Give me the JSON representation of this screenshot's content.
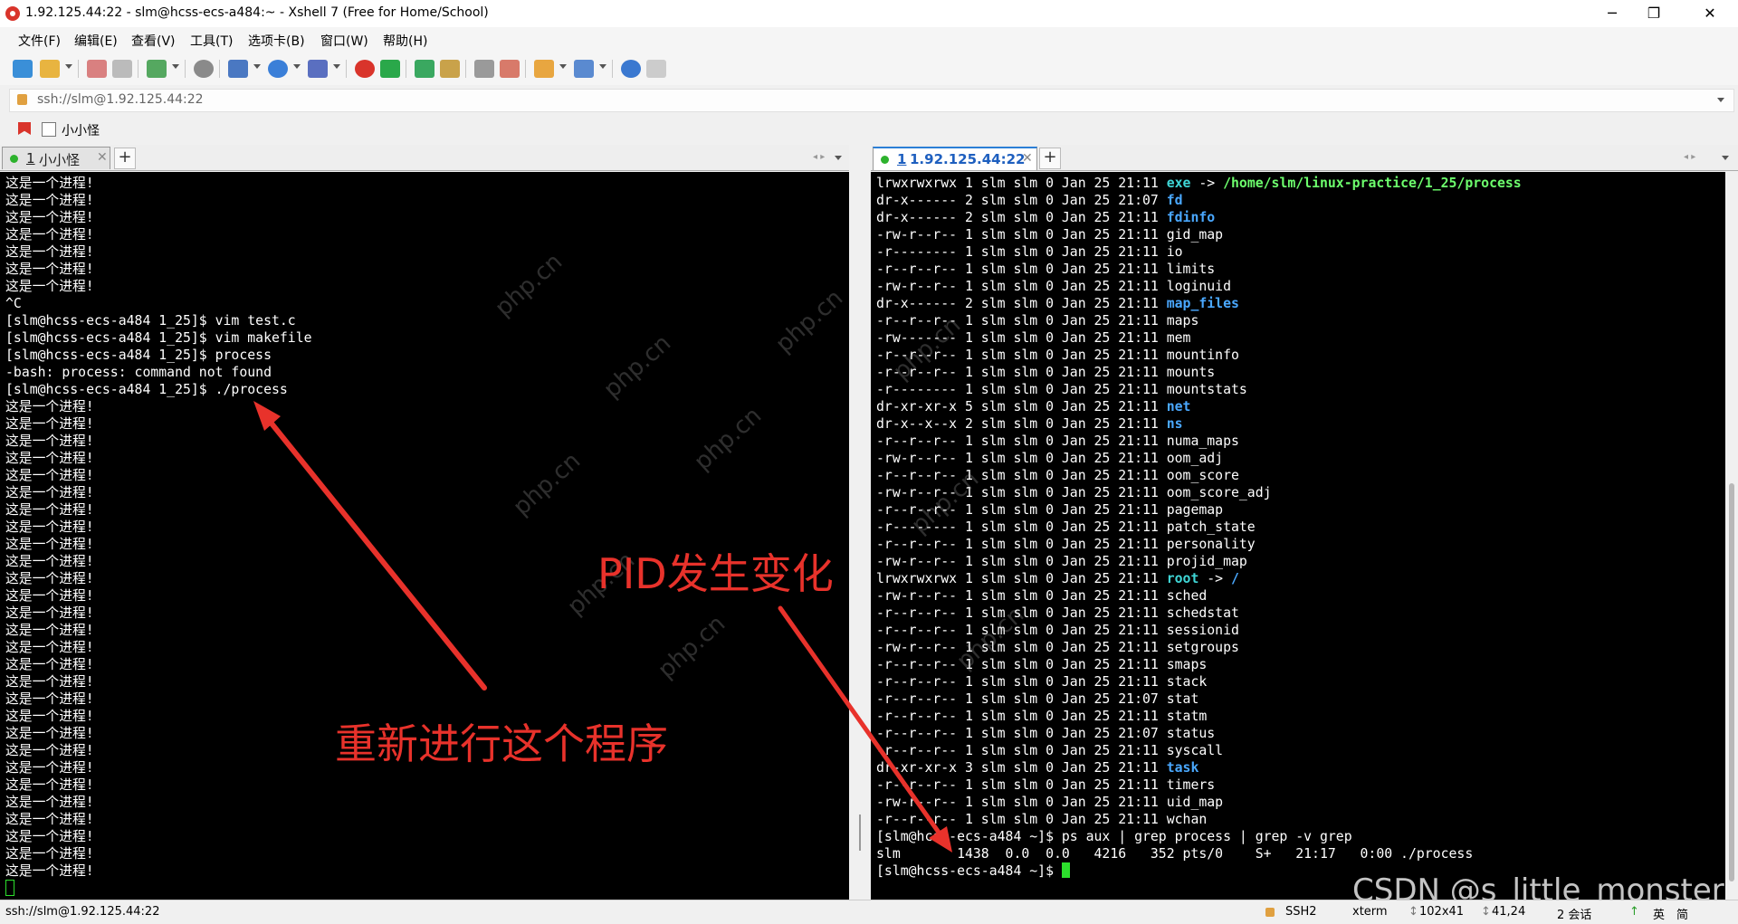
{
  "window": {
    "title": "1.92.125.44:22 - slm@hcss-ecs-a484:~ - Xshell 7 (Free for Home/School)",
    "minimize": "─",
    "maximize": "❐",
    "close": "✕"
  },
  "menu": [
    "文件(F)",
    "编辑(E)",
    "查看(V)",
    "工具(T)",
    "选项卡(B)",
    "窗口(W)",
    "帮助(H)"
  ],
  "address": "ssh://slm@1.92.125.44:22",
  "quickbar": {
    "label": "小小怪"
  },
  "tabs_left": {
    "number": "1",
    "label": "小小怪",
    "close": "✕",
    "add": "+"
  },
  "tabs_right": {
    "number": "1",
    "label": "1.92.125.44:22",
    "close": "✕",
    "add": "+"
  },
  "left_terminal": {
    "lines": [
      "这是一个进程!",
      "这是一个进程!",
      "这是一个进程!",
      "这是一个进程!",
      "这是一个进程!",
      "这是一个进程!",
      "这是一个进程!",
      "^C",
      "[slm@hcss-ecs-a484 1_25]$ vim test.c",
      "[slm@hcss-ecs-a484 1_25]$ vim makefile",
      "[slm@hcss-ecs-a484 1_25]$ process",
      "-bash: process: command not found",
      "[slm@hcss-ecs-a484 1_25]$ ./process",
      "这是一个进程!",
      "这是一个进程!",
      "这是一个进程!",
      "这是一个进程!",
      "这是一个进程!",
      "这是一个进程!",
      "这是一个进程!",
      "这是一个进程!",
      "这是一个进程!",
      "这是一个进程!",
      "这是一个进程!",
      "这是一个进程!",
      "这是一个进程!",
      "这是一个进程!",
      "这是一个进程!",
      "这是一个进程!",
      "这是一个进程!",
      "这是一个进程!",
      "这是一个进程!",
      "这是一个进程!",
      "这是一个进程!",
      "这是一个进程!",
      "这是一个进程!",
      "这是一个进程!",
      "这是一个进程!",
      "这是一个进程!",
      "这是一个进程!",
      "这是一个进程!"
    ]
  },
  "right_terminal": {
    "entries": [
      {
        "perm": "lrwxrwxrwx",
        "links": "1",
        "time": "21:11",
        "name": "exe",
        "type": "link",
        "target": "/home/slm/linux-practice/1_25/process"
      },
      {
        "perm": "dr-x------",
        "links": "2",
        "time": "21:07",
        "name": "fd",
        "type": "dir"
      },
      {
        "perm": "dr-x------",
        "links": "2",
        "time": "21:11",
        "name": "fdinfo",
        "type": "dir"
      },
      {
        "perm": "-rw-r--r--",
        "links": "1",
        "time": "21:11",
        "name": "gid_map",
        "type": "file"
      },
      {
        "perm": "-r--------",
        "links": "1",
        "time": "21:11",
        "name": "io",
        "type": "file"
      },
      {
        "perm": "-r--r--r--",
        "links": "1",
        "time": "21:11",
        "name": "limits",
        "type": "file"
      },
      {
        "perm": "-rw-r--r--",
        "links": "1",
        "time": "21:11",
        "name": "loginuid",
        "type": "file"
      },
      {
        "perm": "dr-x------",
        "links": "2",
        "time": "21:11",
        "name": "map_files",
        "type": "dir"
      },
      {
        "perm": "-r--r--r--",
        "links": "1",
        "time": "21:11",
        "name": "maps",
        "type": "file"
      },
      {
        "perm": "-rw-------",
        "links": "1",
        "time": "21:11",
        "name": "mem",
        "type": "file"
      },
      {
        "perm": "-r--r--r--",
        "links": "1",
        "time": "21:11",
        "name": "mountinfo",
        "type": "file"
      },
      {
        "perm": "-r--r--r--",
        "links": "1",
        "time": "21:11",
        "name": "mounts",
        "type": "file"
      },
      {
        "perm": "-r--------",
        "links": "1",
        "time": "21:11",
        "name": "mountstats",
        "type": "file"
      },
      {
        "perm": "dr-xr-xr-x",
        "links": "5",
        "time": "21:11",
        "name": "net",
        "type": "dir"
      },
      {
        "perm": "dr-x--x--x",
        "links": "2",
        "time": "21:11",
        "name": "ns",
        "type": "dir"
      },
      {
        "perm": "-r--r--r--",
        "links": "1",
        "time": "21:11",
        "name": "numa_maps",
        "type": "file"
      },
      {
        "perm": "-rw-r--r--",
        "links": "1",
        "time": "21:11",
        "name": "oom_adj",
        "type": "file"
      },
      {
        "perm": "-r--r--r--",
        "links": "1",
        "time": "21:11",
        "name": "oom_score",
        "type": "file"
      },
      {
        "perm": "-rw-r--r--",
        "links": "1",
        "time": "21:11",
        "name": "oom_score_adj",
        "type": "file"
      },
      {
        "perm": "-r--r--r--",
        "links": "1",
        "time": "21:11",
        "name": "pagemap",
        "type": "file"
      },
      {
        "perm": "-r--------",
        "links": "1",
        "time": "21:11",
        "name": "patch_state",
        "type": "file"
      },
      {
        "perm": "-r--r--r--",
        "links": "1",
        "time": "21:11",
        "name": "personality",
        "type": "file"
      },
      {
        "perm": "-rw-r--r--",
        "links": "1",
        "time": "21:11",
        "name": "projid_map",
        "type": "file"
      },
      {
        "perm": "lrwxrwxrwx",
        "links": "1",
        "time": "21:11",
        "name": "root",
        "type": "link",
        "target": "/"
      },
      {
        "perm": "-rw-r--r--",
        "links": "1",
        "time": "21:11",
        "name": "sched",
        "type": "file"
      },
      {
        "perm": "-r--r--r--",
        "links": "1",
        "time": "21:11",
        "name": "schedstat",
        "type": "file"
      },
      {
        "perm": "-r--r--r--",
        "links": "1",
        "time": "21:11",
        "name": "sessionid",
        "type": "file"
      },
      {
        "perm": "-rw-r--r--",
        "links": "1",
        "time": "21:11",
        "name": "setgroups",
        "type": "file"
      },
      {
        "perm": "-r--r--r--",
        "links": "1",
        "time": "21:11",
        "name": "smaps",
        "type": "file"
      },
      {
        "perm": "-r--r--r--",
        "links": "1",
        "time": "21:11",
        "name": "stack",
        "type": "file"
      },
      {
        "perm": "-r--r--r--",
        "links": "1",
        "time": "21:07",
        "name": "stat",
        "type": "file"
      },
      {
        "perm": "-r--r--r--",
        "links": "1",
        "time": "21:11",
        "name": "statm",
        "type": "file"
      },
      {
        "perm": "-r--r--r--",
        "links": "1",
        "time": "21:07",
        "name": "status",
        "type": "file"
      },
      {
        "perm": "-r--r--r--",
        "links": "1",
        "time": "21:11",
        "name": "syscall",
        "type": "file"
      },
      {
        "perm": "dr-xr-xr-x",
        "links": "3",
        "time": "21:11",
        "name": "task",
        "type": "dir"
      },
      {
        "perm": "-r--r--r--",
        "links": "1",
        "time": "21:11",
        "name": "timers",
        "type": "file"
      },
      {
        "perm": "-rw-r--r--",
        "links": "1",
        "time": "21:11",
        "name": "uid_map",
        "type": "file"
      },
      {
        "perm": "-r--r--r--",
        "links": "1",
        "time": "21:11",
        "name": "wchan",
        "type": "file"
      }
    ],
    "owner": "slm slm",
    "size": "0",
    "date": "Jan 25",
    "command_line": "[slm@hcss-ecs-a484 ~]$ ps aux | grep process | grep -v grep",
    "ps_output": "slm       1438  0.0  0.0   4216   352 pts/0    S+   21:17   0:00 ./process",
    "prompt": "[slm@hcss-ecs-a484 ~]$ "
  },
  "annotations": {
    "left": "重新进行这个程序",
    "right": "PID发生变化",
    "color": "#e8322b"
  },
  "watermark": {
    "text": "php.cn",
    "credit": "CSDN @s_little_monster_"
  },
  "status": {
    "address": "ssh://slm@1.92.125.44:22",
    "protocol": "SSH2",
    "terminal": "xterm",
    "size": "102x41",
    "cursor": "41,24",
    "sessions": "2 会话",
    "ime": "英",
    "ime2": "简"
  }
}
